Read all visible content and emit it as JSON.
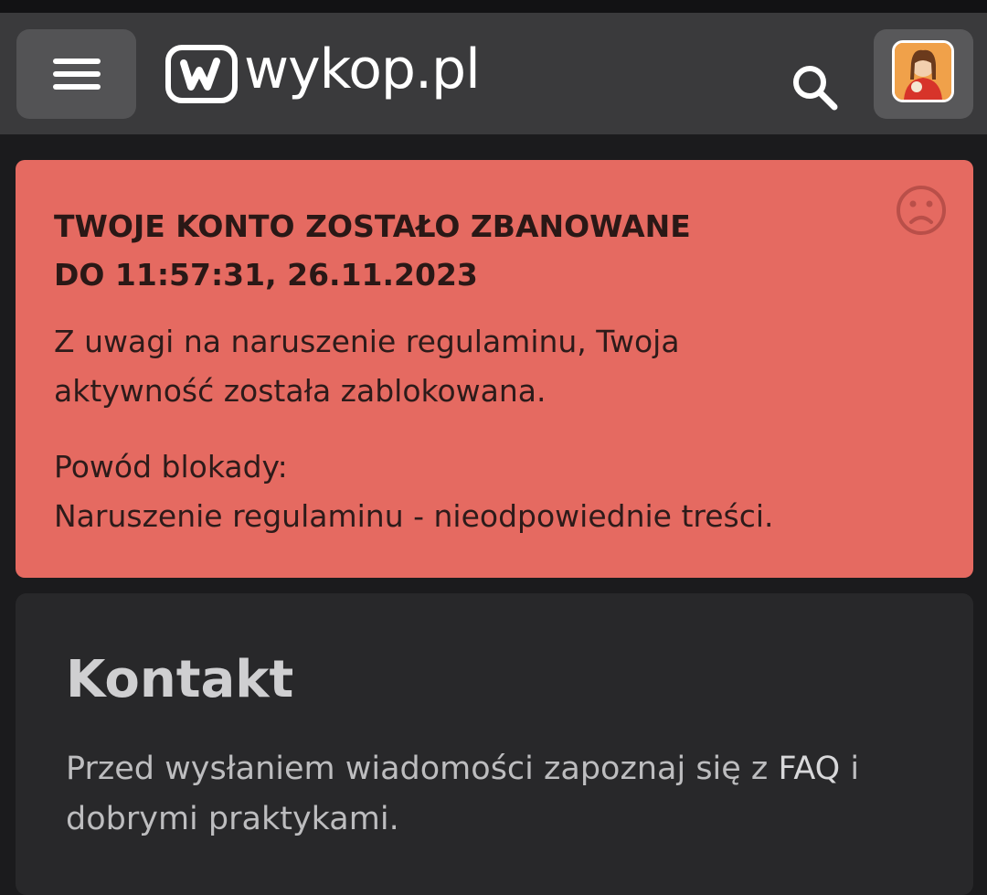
{
  "header": {
    "logo_text": "wykop.pl",
    "menu_icon": "hamburger-menu-icon",
    "search_icon": "search-icon",
    "avatar_icon": "user-avatar"
  },
  "ban": {
    "title_line1": "TWOJE KONTO ZOSTAŁO ZBANOWANE",
    "title_line2": "DO 11:57:31, 26.11.2023",
    "message_line1": "Z uwagi na naruszenie regulaminu, Twoja",
    "message_line2": "aktywność została zablokowana.",
    "reason_label": "Powód blokady:",
    "reason_value": "Naruszenie regulaminu - nieodpowiednie treści.",
    "icon": "sad-face-icon",
    "background_color": "#e56a61"
  },
  "contact": {
    "title": "Kontakt",
    "text_before_link": "Przed wysłaniem wiadomości zapoznaj się z ",
    "faq_link": "FAQ",
    "text_middle": " i",
    "text_line2": "dobrymi praktykami."
  }
}
